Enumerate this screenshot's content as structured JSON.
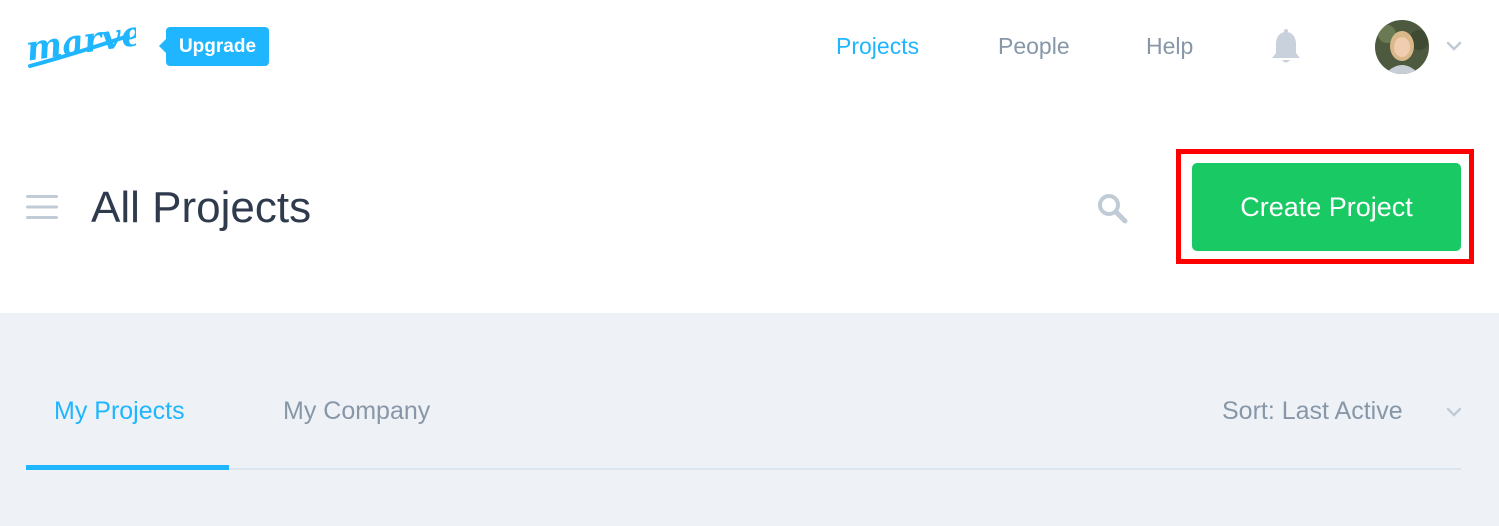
{
  "brand": {
    "logo_text": "marvel",
    "upgrade_label": "Upgrade"
  },
  "nav": {
    "items": [
      {
        "label": "Projects",
        "active": true
      },
      {
        "label": "People",
        "active": false
      },
      {
        "label": "Help",
        "active": false
      }
    ],
    "bell_icon": "bell-icon",
    "avatar_icon": "avatar",
    "menu_chevron_icon": "chevron-down-icon"
  },
  "header": {
    "menu_icon": "hamburger-icon",
    "title": "All Projects",
    "search_icon": "search-icon",
    "create_label": "Create Project"
  },
  "tabs": [
    {
      "label": "My Projects",
      "active": true
    },
    {
      "label": "My Company",
      "active": false
    }
  ],
  "sort": {
    "label": "Sort: Last Active"
  },
  "colors": {
    "accent": "#1fb6ff",
    "create": "#19c964",
    "highlight": "#ff0000",
    "muted_text": "#8797a8",
    "title_text": "#2f3b4c",
    "section_bg": "#eef2f6"
  }
}
